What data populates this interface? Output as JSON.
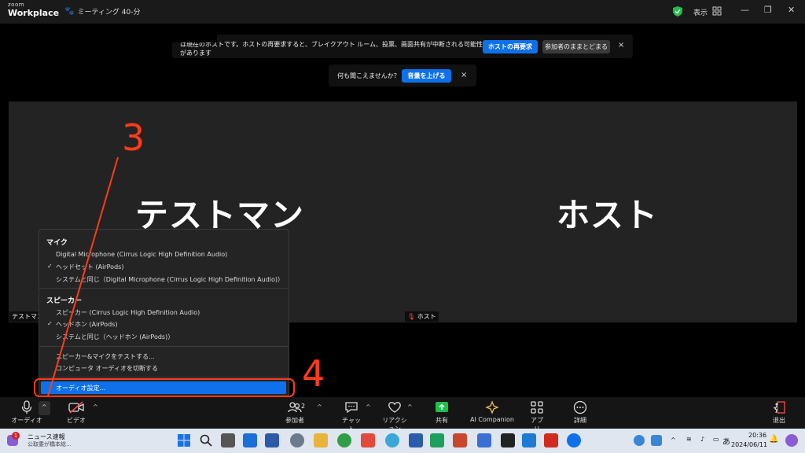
{
  "app": {
    "logo_small": "zoom",
    "logo_big": "Workplace",
    "meeting_label": "ミーティング 40-分",
    "view_label": "表示"
  },
  "host_banner": {
    "text": "は現在のホストです。ホストの再要求すると、ブレイクアウト ルーム、投票、画面共有が中断される可能性があります",
    "reclaim_label": "ホストの再要求",
    "stay_label": "参加者のままとどまる",
    "close": "×"
  },
  "audio_banner": {
    "text": "何も聞こえませんか？",
    "button_label": "音量を上げる",
    "close": "×"
  },
  "tiles": {
    "left_name": "テストマン",
    "right_name": "ホスト",
    "left_tag": "テストマン",
    "right_tag": "ホスト"
  },
  "audio_menu": {
    "mic_header": "マイク",
    "mic_items": [
      {
        "label": "Digital Microphone (Cirrus Logic High Definition Audio)",
        "checked": false
      },
      {
        "label": "ヘッドセット (AirPods)",
        "checked": true
      },
      {
        "label": "システムと同じ（Digital Microphone (Cirrus Logic High Definition Audio)）",
        "checked": false
      }
    ],
    "speaker_header": "スピーカー",
    "speaker_items": [
      {
        "label": "スピーカー (Cirrus Logic High Definition Audio)",
        "checked": false
      },
      {
        "label": "ヘッドホン (AirPods)",
        "checked": true
      },
      {
        "label": "システムと同じ（ヘッドホン (AirPods)）",
        "checked": false
      }
    ],
    "test_label": "スピーカー&マイクをテストする...",
    "switch_label": "コンピュータ オーディオを切断する",
    "settings_label": "オーディオ設定...",
    "check_mark": "✓"
  },
  "annotations": {
    "step3": "3",
    "step4": "4",
    "color": "#ff3b1a"
  },
  "toolbar": {
    "audio_label": "オーディオ",
    "video_label": "ビデオ",
    "participants_label": "参加者",
    "participants_count": "2",
    "chat_label": "チャット",
    "reactions_label": "リアクション",
    "share_label": "共有",
    "ai_label": "AI Companion",
    "apps_label": "アプリ",
    "more_label": "詳細",
    "leave_label": "退出",
    "caret": "^"
  },
  "taskbar": {
    "news_badge": "1",
    "news_title": "ニュース速報",
    "news_sub": "公取委が橋本総...",
    "ime": "あ",
    "time": "20:36",
    "date": "2024/06/11"
  }
}
